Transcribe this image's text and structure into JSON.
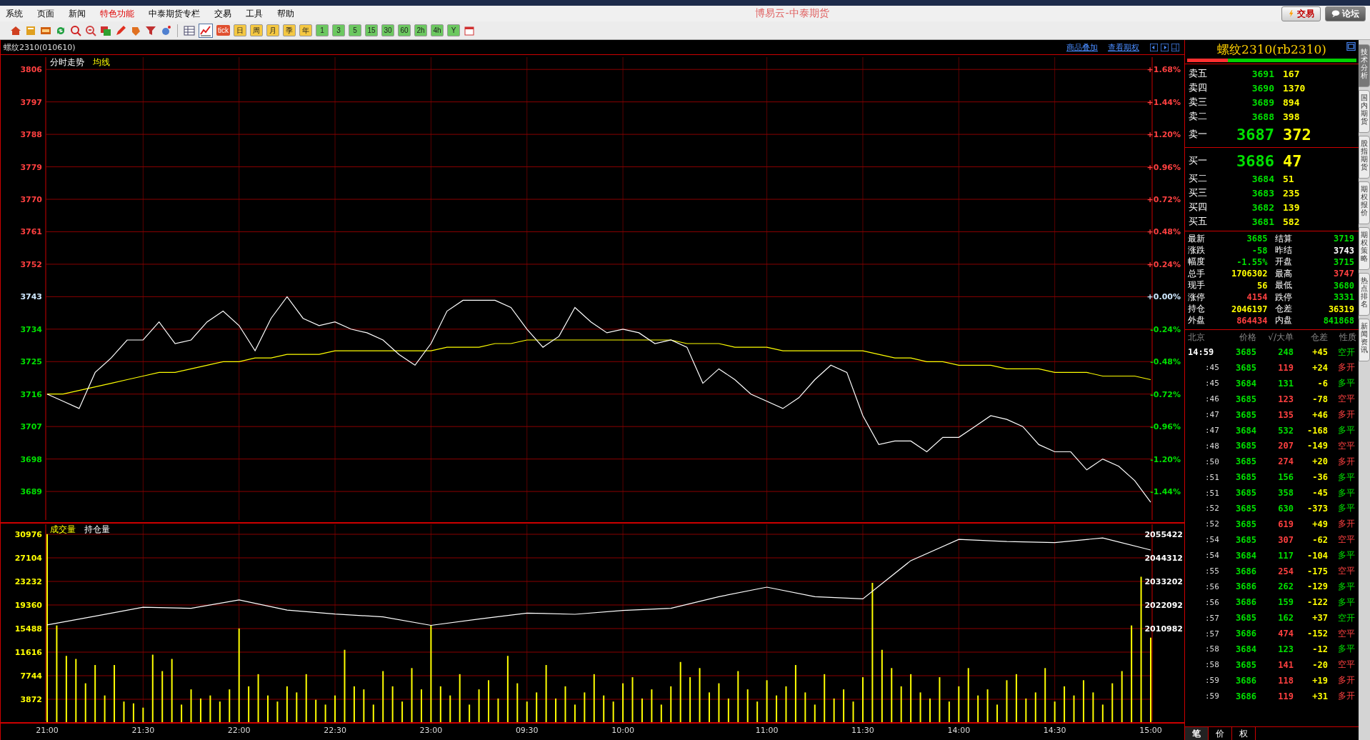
{
  "menu_bar": {
    "items": [
      {
        "label": "系统",
        "highlight": false
      },
      {
        "label": "页面",
        "highlight": false
      },
      {
        "label": "新闻",
        "highlight": false
      },
      {
        "label": "特色功能",
        "highlight": true
      },
      {
        "label": "中泰期货专栏",
        "highlight": false
      },
      {
        "label": "交易",
        "highlight": false
      },
      {
        "label": "工具",
        "highlight": false
      },
      {
        "label": "帮助",
        "highlight": false
      }
    ],
    "title": "博易云-中泰期货",
    "buttons": [
      {
        "label": "交易",
        "kind": "trade"
      },
      {
        "label": "论坛",
        "kind": "forum"
      }
    ]
  },
  "toolbar": {
    "intraday_view_selected": true,
    "tick_label": "tick",
    "period_buttons": [
      {
        "label": "日",
        "kind": "calendar"
      },
      {
        "label": "周",
        "kind": "calendar"
      },
      {
        "label": "月",
        "kind": "calendar"
      },
      {
        "label": "季",
        "kind": "calendar"
      },
      {
        "label": "年",
        "kind": "calendar"
      },
      {
        "label": "1",
        "kind": "minute"
      },
      {
        "label": "3",
        "kind": "minute"
      },
      {
        "label": "5",
        "kind": "minute"
      },
      {
        "label": "15",
        "kind": "minute"
      },
      {
        "label": "30",
        "kind": "minute"
      },
      {
        "label": "60",
        "kind": "minute"
      },
      {
        "label": "2h",
        "kind": "minute"
      },
      {
        "label": "4h",
        "kind": "minute"
      },
      {
        "label": "Y",
        "kind": "minute"
      }
    ]
  },
  "chart_header": {
    "title": "螺纹2310(010610)",
    "links": [
      "商品叠加",
      "查看期权"
    ]
  },
  "price_panel": {
    "right_axis_labels": [
      {
        "label": "+1.68%",
        "kind": "rise"
      },
      {
        "label": "+1.44%",
        "kind": "rise"
      },
      {
        "label": "+1.20%",
        "kind": "rise"
      },
      {
        "label": "+0.96%",
        "kind": "rise"
      },
      {
        "label": "+0.72%",
        "kind": "rise"
      },
      {
        "label": "+0.48%",
        "kind": "rise"
      },
      {
        "label": "+0.24%",
        "kind": "rise"
      },
      {
        "label": "+0.00%",
        "kind": "flat"
      },
      {
        "label": "-0.24%",
        "kind": "fall"
      },
      {
        "label": "-0.48%",
        "kind": "fall"
      },
      {
        "label": "-0.72%",
        "kind": "fall"
      },
      {
        "label": "-0.96%",
        "kind": "fall"
      },
      {
        "label": "-1.20%",
        "kind": "fall"
      },
      {
        "label": "-1.44%",
        "kind": "fall"
      }
    ],
    "chart_data": {
      "type": "line",
      "grid": true,
      "ylim": [
        3680.5,
        3810
      ],
      "yticks": [
        {
          "value": 3806,
          "label": "3806"
        },
        {
          "value": 3797,
          "label": "3797"
        },
        {
          "value": 3788,
          "label": "3788"
        },
        {
          "value": 3779,
          "label": "3779"
        },
        {
          "value": 3770,
          "label": "3770"
        },
        {
          "value": 3761,
          "label": "3761"
        },
        {
          "value": 3752,
          "label": "3752"
        },
        {
          "value": 3743,
          "label": "3743"
        },
        {
          "value": 3734,
          "label": "3734"
        },
        {
          "value": 3725,
          "label": "3725"
        },
        {
          "value": 3716,
          "label": "3716"
        },
        {
          "value": 3707,
          "label": "3707"
        },
        {
          "value": 3698,
          "label": "3698"
        },
        {
          "value": 3689,
          "label": "3689"
        }
      ],
      "categories": [
        null,
        null,
        null,
        null,
        null,
        null,
        null,
        null,
        null,
        null,
        null,
        null,
        null,
        null,
        null,
        null,
        null,
        null,
        null,
        null,
        null,
        null,
        null,
        null,
        null,
        null,
        null,
        null,
        null,
        null,
        null,
        null,
        null,
        null,
        null,
        null,
        null,
        null,
        null,
        null,
        null,
        null,
        null,
        null,
        null,
        null,
        null,
        null,
        null,
        null,
        null,
        null,
        null,
        null,
        null,
        null,
        null,
        null,
        null,
        null,
        null,
        null,
        null,
        null,
        null,
        null,
        null,
        null,
        null,
        null
      ],
      "series": [
        {
          "name": "分时走势",
          "color": "#ffffff",
          "values": [
            3716,
            3714,
            3712,
            3722,
            3726,
            3731,
            3731,
            3736,
            3730,
            3731,
            3736,
            3739,
            3735,
            3728,
            3737,
            3743,
            3737,
            3735,
            3736,
            3734,
            3733,
            3731,
            3727,
            3724,
            3730,
            3739,
            3742,
            3742,
            3742,
            3740,
            3734,
            3729,
            3732,
            3740,
            3736,
            3733,
            3734,
            3733,
            3730,
            3731,
            3729,
            3719,
            3723,
            3720,
            3716,
            3714,
            3712,
            3715,
            3720,
            3724,
            3722,
            3710,
            3702,
            3703,
            3703,
            3700,
            3704,
            3704,
            3707,
            3710,
            3709,
            3707,
            3702,
            3700,
            3700,
            3695,
            3698,
            3696,
            3692,
            3686
          ]
        },
        {
          "name": "均线",
          "color": "#ffff00",
          "values": [
            3716,
            3716,
            3717,
            3718,
            3719,
            3720,
            3721,
            3722,
            3722,
            3723,
            3724,
            3725,
            3725,
            3726,
            3726,
            3727,
            3727,
            3727,
            3728,
            3728,
            3728,
            3728,
            3728,
            3728,
            3728,
            3729,
            3729,
            3729,
            3730,
            3730,
            3731,
            3731,
            3731,
            3731,
            3731,
            3731,
            3731,
            3731,
            3731,
            3731,
            3730,
            3730,
            3730,
            3729,
            3729,
            3729,
            3728,
            3728,
            3728,
            3728,
            3728,
            3728,
            3727,
            3726,
            3726,
            3725,
            3725,
            3724,
            3724,
            3724,
            3723,
            3723,
            3723,
            3722,
            3722,
            3722,
            3721,
            3721,
            3721,
            3720
          ]
        }
      ]
    }
  },
  "volume_panel": {
    "chart_data": {
      "type": "bar",
      "grid": true,
      "ylim": [
        0,
        32970
      ],
      "yticks": [
        {
          "value": 30976,
          "label": "30976"
        },
        {
          "value": 27104,
          "label": "27104"
        },
        {
          "value": 23232,
          "label": "23232"
        },
        {
          "value": 19360,
          "label": "19360"
        },
        {
          "value": 15488,
          "label": "15488"
        },
        {
          "value": 11616,
          "label": "11616"
        },
        {
          "value": 7744,
          "label": "7744"
        },
        {
          "value": 3872,
          "label": "3872"
        }
      ],
      "categories": [
        "21:00",
        null,
        null,
        null,
        null,
        null,
        null,
        null,
        null,
        null,
        "21:30",
        null,
        null,
        null,
        null,
        null,
        null,
        null,
        null,
        null,
        "22:00",
        null,
        null,
        null,
        null,
        null,
        null,
        null,
        null,
        null,
        "22:30",
        null,
        null,
        null,
        null,
        null,
        null,
        null,
        null,
        null,
        "23:00",
        null,
        null,
        null,
        null,
        null,
        null,
        null,
        null,
        null,
        "09:30",
        null,
        null,
        null,
        null,
        null,
        null,
        null,
        null,
        null,
        "10:00",
        null,
        null,
        null,
        null,
        null,
        null,
        null,
        null,
        null,
        null,
        null,
        null,
        null,
        null,
        "11:00",
        null,
        null,
        null,
        null,
        null,
        null,
        null,
        null,
        null,
        "11:30",
        null,
        null,
        null,
        null,
        null,
        null,
        null,
        null,
        null,
        "14:00",
        null,
        null,
        null,
        null,
        null,
        null,
        null,
        null,
        null,
        "14:30",
        null,
        null,
        null,
        null,
        null,
        null,
        null,
        null,
        null,
        "15:00"
      ],
      "series": [
        {
          "name": "成交量",
          "color": "#ffff00",
          "values": [
            31000,
            16000,
            11000,
            10500,
            6500,
            9500,
            4500,
            9500,
            3500,
            3200,
            2500,
            11200,
            8500,
            10500,
            3000,
            5500,
            4000,
            4500,
            3500,
            5500,
            15500,
            6000,
            8000,
            4500,
            3500,
            6000,
            5000,
            8000,
            3800,
            3000,
            4500,
            12000,
            6000,
            5500,
            3000,
            8500,
            6000,
            3500,
            9000,
            5500,
            16000,
            6000,
            4500,
            8000,
            3000,
            5500,
            7000,
            4000,
            11000,
            6500,
            3500,
            5000,
            9500,
            4000,
            6000,
            3000,
            5000,
            8000,
            4500,
            3500,
            6500,
            7500,
            4000,
            5500,
            3000,
            6000,
            10000,
            7500,
            9000,
            5000,
            6500,
            4000,
            8500,
            5500,
            3500,
            7000,
            4500,
            6000,
            9500,
            5000,
            3000,
            8000,
            4000,
            5500,
            3500,
            7500,
            23000,
            12000,
            9000,
            6000,
            8000,
            5000,
            4000,
            7500,
            3500,
            6000,
            9000,
            4500,
            5500,
            3000,
            7000,
            8000,
            4000,
            5000,
            9000,
            3500,
            6000,
            4500,
            7000,
            5000,
            3000,
            6500,
            8500,
            16000,
            24000,
            14000
          ]
        }
      ]
    }
  },
  "open_interest_panel": {
    "chart_data": {
      "type": "line",
      "ylim": [
        1966542,
        2061145
      ],
      "yticks": [
        {
          "value": 2055422,
          "label": "2055422"
        },
        {
          "value": 2044312,
          "label": "2044312"
        },
        {
          "value": 2033202,
          "label": "2033202"
        },
        {
          "value": 2022092,
          "label": "2022092"
        },
        {
          "value": 2010982,
          "label": "2010982"
        }
      ],
      "categories": [
        null,
        null,
        null,
        null,
        null,
        null,
        null,
        null,
        null,
        null,
        null,
        null,
        null,
        null,
        null,
        null,
        null,
        null,
        null,
        null,
        null,
        null,
        null,
        null
      ],
      "series": [
        {
          "name": "持仓量",
          "color": "#ffffff",
          "values": [
            2012700,
            2016800,
            2021000,
            2020500,
            2024500,
            2019700,
            2017800,
            2016500,
            2012500,
            2015500,
            2018300,
            2017700,
            2019500,
            2020500,
            2026000,
            2030500,
            2026000,
            2025000,
            2043000,
            2053000,
            2052000,
            2051500,
            2053700,
            2048000
          ]
        }
      ]
    }
  },
  "quote": {
    "title": "螺纹2310(rb2310)",
    "strength_bar": {
      "level": 0.24
    },
    "asks": [
      {
        "label": "卖五",
        "price": "3691",
        "volume": "167",
        "kind": "level"
      },
      {
        "label": "卖四",
        "price": "3690",
        "volume": "1370",
        "kind": "level"
      },
      {
        "label": "卖三",
        "price": "3689",
        "volume": "894",
        "kind": "level"
      },
      {
        "label": "卖二",
        "price": "3688",
        "volume": "398",
        "kind": "level"
      },
      {
        "label": "卖一",
        "price": "3687",
        "volume": "372",
        "kind": "best"
      }
    ],
    "bids": [
      {
        "label": "买一",
        "price": "3686",
        "volume": "47",
        "kind": "best"
      },
      {
        "label": "买二",
        "price": "3684",
        "volume": "51",
        "kind": "level"
      },
      {
        "label": "买三",
        "price": "3683",
        "volume": "235",
        "kind": "level"
      },
      {
        "label": "买四",
        "price": "3682",
        "volume": "139",
        "kind": "level"
      },
      {
        "label": "买五",
        "price": "3681",
        "volume": "582",
        "kind": "level"
      }
    ],
    "stats": [
      {
        "label": "最新",
        "value": "3685",
        "kind": "fall"
      },
      {
        "label": "结算",
        "value": "3719",
        "kind": "fall"
      },
      {
        "label": "涨跌",
        "value": "-58",
        "kind": "fall"
      },
      {
        "label": "昨结",
        "value": "3743",
        "kind": "flat"
      },
      {
        "label": "幅度",
        "value": "-1.55%",
        "kind": "fall"
      },
      {
        "label": "开盘",
        "value": "3715",
        "kind": "fall"
      },
      {
        "label": "总手",
        "value": "1706302",
        "kind": "volume"
      },
      {
        "label": "最高",
        "value": "3747",
        "kind": "rise"
      },
      {
        "label": "现手",
        "value": "56",
        "kind": "volume"
      },
      {
        "label": "最低",
        "value": "3680",
        "kind": "fall"
      },
      {
        "label": "涨停",
        "value": "4154",
        "kind": "rise"
      },
      {
        "label": "跌停",
        "value": "3331",
        "kind": "fall"
      },
      {
        "label": "持仓",
        "value": "2046197",
        "kind": "volume"
      },
      {
        "label": "仓差",
        "value": "36319",
        "kind": "volume"
      },
      {
        "label": "外盘",
        "value": "864434",
        "kind": "rise"
      },
      {
        "label": "内盘",
        "value": "841868",
        "kind": "fall"
      }
    ]
  },
  "ticks": {
    "columns": [
      "北京",
      "价格",
      "√/大单",
      "仓差",
      "性质"
    ],
    "rows": [
      {
        "time": "14:59",
        "price": "3685",
        "volume": "248",
        "oi_change": "+45",
        "nature": "空开",
        "kind": "sell",
        "full_time": true
      },
      {
        "time": ":45",
        "price": "3685",
        "volume": "119",
        "oi_change": "+24",
        "nature": "多开",
        "kind": "buy",
        "full_time": false
      },
      {
        "time": ":45",
        "price": "3684",
        "volume": "131",
        "oi_change": "-6",
        "nature": "多平",
        "kind": "sell",
        "full_time": false
      },
      {
        "time": ":46",
        "price": "3685",
        "volume": "123",
        "oi_change": "-78",
        "nature": "空平",
        "kind": "buy",
        "full_time": false
      },
      {
        "time": ":47",
        "price": "3685",
        "volume": "135",
        "oi_change": "+46",
        "nature": "多开",
        "kind": "buy",
        "full_time": false
      },
      {
        "time": ":47",
        "price": "3684",
        "volume": "532",
        "oi_change": "-168",
        "nature": "多平",
        "kind": "sell",
        "full_time": false
      },
      {
        "time": ":48",
        "price": "3685",
        "volume": "207",
        "oi_change": "-149",
        "nature": "空平",
        "kind": "buy",
        "full_time": false
      },
      {
        "time": ":50",
        "price": "3685",
        "volume": "274",
        "oi_change": "+20",
        "nature": "多开",
        "kind": "buy",
        "full_time": false
      },
      {
        "time": ":51",
        "price": "3685",
        "volume": "156",
        "oi_change": "-36",
        "nature": "多平",
        "kind": "sell",
        "full_time": false
      },
      {
        "time": ":51",
        "price": "3685",
        "volume": "358",
        "oi_change": "-45",
        "nature": "多平",
        "kind": "sell",
        "full_time": false
      },
      {
        "time": ":52",
        "price": "3685",
        "volume": "630",
        "oi_change": "-373",
        "nature": "多平",
        "kind": "sell",
        "full_time": false
      },
      {
        "time": ":52",
        "price": "3685",
        "volume": "619",
        "oi_change": "+49",
        "nature": "多开",
        "kind": "buy",
        "full_time": false
      },
      {
        "time": ":54",
        "price": "3685",
        "volume": "307",
        "oi_change": "-62",
        "nature": "空平",
        "kind": "buy",
        "full_time": false
      },
      {
        "time": ":54",
        "price": "3684",
        "volume": "117",
        "oi_change": "-104",
        "nature": "多平",
        "kind": "sell",
        "full_time": false
      },
      {
        "time": ":55",
        "price": "3686",
        "volume": "254",
        "oi_change": "-175",
        "nature": "空平",
        "kind": "buy",
        "full_time": false
      },
      {
        "time": ":56",
        "price": "3686",
        "volume": "262",
        "oi_change": "-129",
        "nature": "多平",
        "kind": "sell",
        "full_time": false
      },
      {
        "time": ":56",
        "price": "3686",
        "volume": "159",
        "oi_change": "-122",
        "nature": "多平",
        "kind": "sell",
        "full_time": false
      },
      {
        "time": ":57",
        "price": "3685",
        "volume": "162",
        "oi_change": "+37",
        "nature": "空开",
        "kind": "sell",
        "full_time": false
      },
      {
        "time": ":57",
        "price": "3686",
        "volume": "474",
        "oi_change": "-152",
        "nature": "空平",
        "kind": "buy",
        "full_time": false
      },
      {
        "time": ":58",
        "price": "3684",
        "volume": "123",
        "oi_change": "-12",
        "nature": "多平",
        "kind": "sell",
        "full_time": false
      },
      {
        "time": ":58",
        "price": "3685",
        "volume": "141",
        "oi_change": "-20",
        "nature": "空平",
        "kind": "buy",
        "full_time": false
      },
      {
        "time": ":59",
        "price": "3686",
        "volume": "118",
        "oi_change": "+19",
        "nature": "多开",
        "kind": "buy",
        "full_time": false
      },
      {
        "time": ":59",
        "price": "3686",
        "volume": "119",
        "oi_change": "+31",
        "nature": "多开",
        "kind": "buy",
        "full_time": false
      }
    ]
  },
  "bottom_tabs": [
    {
      "label": "笔",
      "selected": true
    },
    {
      "label": "价",
      "selected": false
    },
    {
      "label": "权",
      "selected": false
    }
  ],
  "side_tabs": [
    {
      "label": "技术分析",
      "selected": true
    },
    {
      "label": "国内期货",
      "selected": false
    },
    {
      "label": "股指期货",
      "selected": false
    },
    {
      "label": "期权报价",
      "selected": false
    },
    {
      "label": "期权策略",
      "selected": false
    },
    {
      "label": "热点排名",
      "selected": false
    },
    {
      "label": "新闻资讯",
      "selected": false
    }
  ]
}
